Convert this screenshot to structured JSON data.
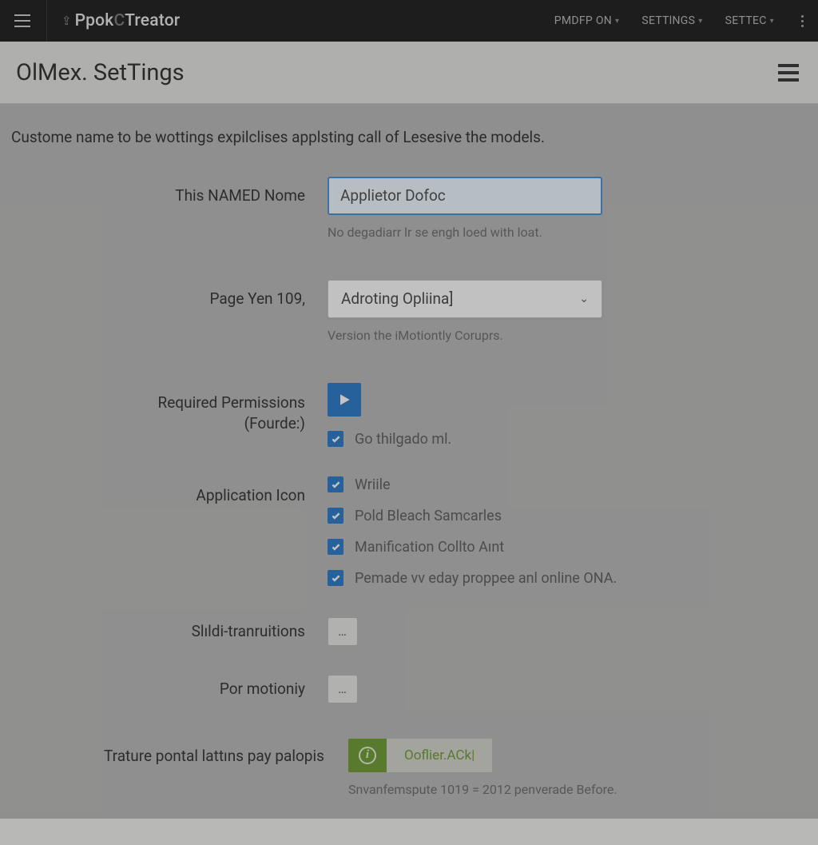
{
  "topbar": {
    "brand_prefix": "Ppok",
    "brand_mid": "C",
    "brand_suffix": "Treator",
    "menu": [
      {
        "label": "PMDFP ON"
      },
      {
        "label": "SETTlNGS"
      },
      {
        "label": "SETTEC"
      }
    ]
  },
  "page": {
    "title": "OlMex. SetTings",
    "description": "Custome name to be wottings expilclises applsting call of Lesesive the models."
  },
  "form": {
    "name": {
      "label": "This NAMED Nome",
      "value": "Applietor Dofoc",
      "hint": "No degadiarr lr se engh loed with loat."
    },
    "version": {
      "label": "Page Yen 109,",
      "selected": "Adroting Opliina]",
      "hint": "Version the iMotiontly Coruprs."
    },
    "permissions": {
      "label_line1": "Required Permissions",
      "label_line2": "(Fourde:)",
      "items": [
        {
          "label": "Go thilgado ml."
        }
      ]
    },
    "app_icon": {
      "label": "Application Icon",
      "items": [
        {
          "label": "Wriile"
        },
        {
          "label": "Pold Bleach Samcarles"
        },
        {
          "label": "Manification Collto Aınt"
        },
        {
          "label": "Pemade vv eday proppee anl online ONA."
        }
      ]
    },
    "transitions": {
      "label": "Slıldi-tranruitions"
    },
    "motion": {
      "label": "Por motioniy"
    },
    "portal": {
      "label": "Trature pontal lattıns pay palopis",
      "button": "Ooflier.ACk|",
      "hint": "Snvanfemspute 1019 = 2012 penverade Before."
    }
  }
}
